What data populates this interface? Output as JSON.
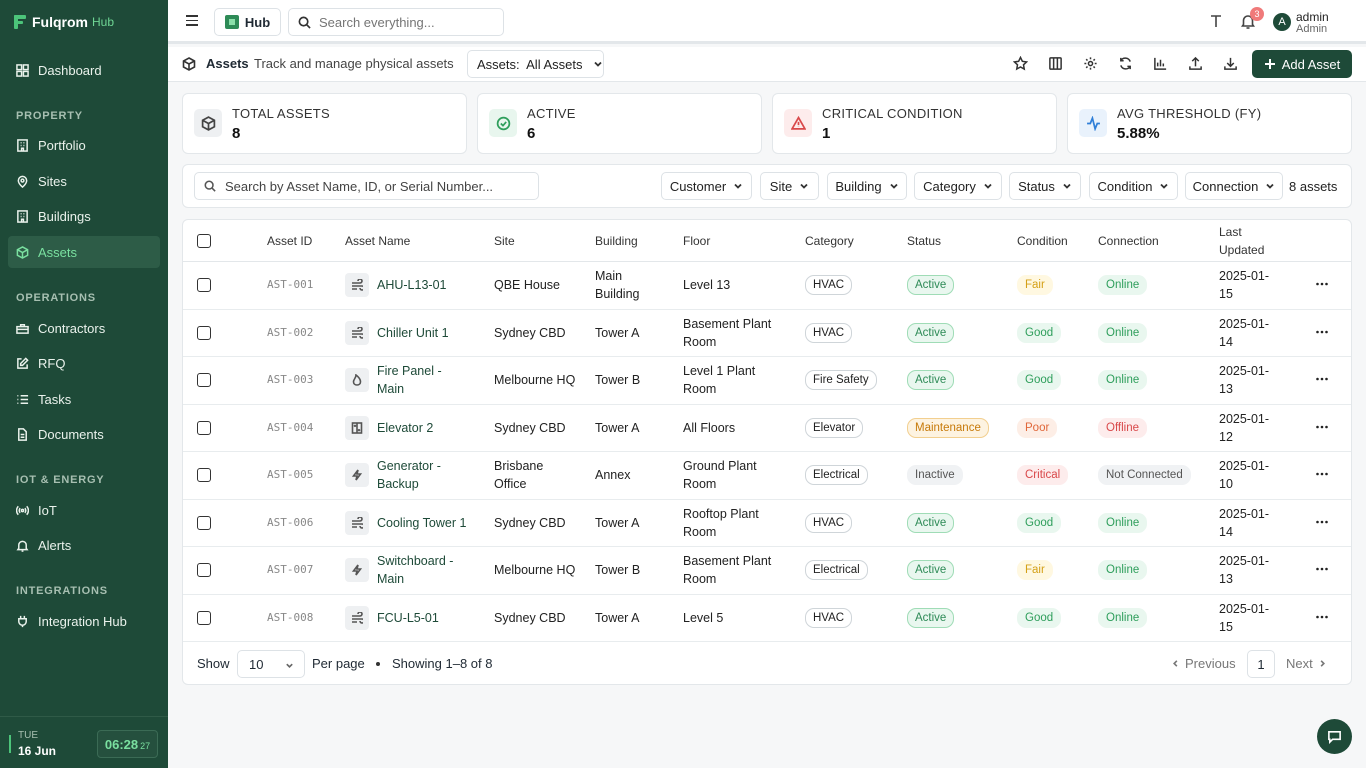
{
  "brand": {
    "name": "Fulqrom",
    "sub": "Hub"
  },
  "sidebar": {
    "dashboard": "Dashboard",
    "sections": [
      "PROPERTY",
      "OPERATIONS",
      "IOT & ENERGY",
      "INTEGRATIONS"
    ],
    "items": [
      {
        "label": "Portfolio",
        "icon": "building-icon"
      },
      {
        "label": "Sites",
        "icon": "pin-icon"
      },
      {
        "label": "Buildings",
        "icon": "building-icon"
      },
      {
        "label": "Assets",
        "icon": "box-icon",
        "active": true
      },
      {
        "label": "Contractors",
        "icon": "toolbox-icon"
      },
      {
        "label": "RFQ",
        "icon": "edit-icon"
      },
      {
        "label": "Tasks",
        "icon": "list-icon"
      },
      {
        "label": "Documents",
        "icon": "document-icon"
      },
      {
        "label": "IoT",
        "icon": "signal-icon"
      },
      {
        "label": "Alerts",
        "icon": "bell-icon"
      },
      {
        "label": "Integration Hub",
        "icon": "plug-icon"
      }
    ],
    "footer": {
      "day": "TUE",
      "date": "16 Jun",
      "time": "06:28",
      "seconds": "27"
    }
  },
  "topbar": {
    "hub_label": "Hub",
    "search_placeholder": "Search everything...",
    "notification_count": "3",
    "avatar_initial": "A",
    "user_name": "admin",
    "user_role": "Admin"
  },
  "page": {
    "title": "Assets",
    "description": "Track and manage physical assets",
    "view_select": "Assets:  All Assets",
    "add_button": "Add Asset"
  },
  "stats": [
    {
      "label": "TOTAL ASSETS",
      "value": "8",
      "color": "#444444",
      "bg": "#eef0f2"
    },
    {
      "label": "ACTIVE",
      "value": "6",
      "color": "#2e9e5b",
      "bg": "#e8f6ee"
    },
    {
      "label": "CRITICAL CONDITION",
      "value": "1",
      "color": "#d9484a",
      "bg": "#fdecec"
    },
    {
      "label": "AVG THRESHOLD (FY)",
      "value": "5.88%",
      "color": "#2f7fd8",
      "bg": "#e9f2fc"
    }
  ],
  "filters": {
    "search_placeholder": "Search by Asset Name, ID, or Serial Number...",
    "labels": [
      "Customer",
      "Site",
      "Building",
      "Category",
      "Status",
      "Condition",
      "Connection"
    ],
    "count": "8 assets"
  },
  "table": {
    "headers": [
      "Asset ID",
      "Asset Name",
      "Site",
      "Building",
      "Floor",
      "Category",
      "Status",
      "Condition",
      "Connection",
      "Last\nUpdated"
    ],
    "rows": [
      {
        "id": "AST-001",
        "icon": "hvac-icon",
        "name": "AHU-L13-01",
        "site": "QBE House",
        "building": "Main Building",
        "floor": "Level 13",
        "category": "HVAC",
        "status": "Active",
        "condition": "Fair",
        "connection": "Online",
        "updated": "2025-01-15"
      },
      {
        "id": "AST-002",
        "icon": "hvac-icon",
        "name": "Chiller Unit 1",
        "site": "Sydney CBD",
        "building": "Tower A",
        "floor": "Basement Plant Room",
        "category": "HVAC",
        "status": "Active",
        "condition": "Good",
        "connection": "Online",
        "updated": "2025-01-14"
      },
      {
        "id": "AST-003",
        "icon": "flame-icon",
        "name": "Fire Panel - Main",
        "site": "Melbourne HQ",
        "building": "Tower B",
        "floor": "Level 1 Plant Room",
        "category": "Fire Safety",
        "status": "Active",
        "condition": "Good",
        "connection": "Online",
        "updated": "2025-01-13"
      },
      {
        "id": "AST-004",
        "icon": "elevator-icon",
        "name": "Elevator 2",
        "site": "Sydney CBD",
        "building": "Tower A",
        "floor": "All Floors",
        "category": "Elevator",
        "status": "Maintenance",
        "condition": "Poor",
        "connection": "Offline",
        "updated": "2025-01-12"
      },
      {
        "id": "AST-005",
        "icon": "bolt-icon",
        "name": "Generator - Backup",
        "site": "Brisbane Office",
        "building": "Annex",
        "floor": "Ground Plant Room",
        "category": "Electrical",
        "status": "Inactive",
        "condition": "Critical",
        "connection": "Not Connected",
        "updated": "2025-01-10"
      },
      {
        "id": "AST-006",
        "icon": "hvac-icon",
        "name": "Cooling Tower 1",
        "site": "Sydney CBD",
        "building": "Tower A",
        "floor": "Rooftop Plant Room",
        "category": "HVAC",
        "status": "Active",
        "condition": "Good",
        "connection": "Online",
        "updated": "2025-01-14"
      },
      {
        "id": "AST-007",
        "icon": "bolt-icon",
        "name": "Switchboard - Main",
        "site": "Melbourne HQ",
        "building": "Tower B",
        "floor": "Basement Plant Room",
        "category": "Electrical",
        "status": "Active",
        "condition": "Fair",
        "connection": "Online",
        "updated": "2025-01-13"
      },
      {
        "id": "AST-008",
        "icon": "hvac-icon",
        "name": "FCU-L5-01",
        "site": "Sydney CBD",
        "building": "Tower A",
        "floor": "Level 5",
        "category": "HVAC",
        "status": "Active",
        "condition": "Good",
        "connection": "Online",
        "updated": "2025-01-15"
      }
    ]
  },
  "pill_colors": {
    "Active": {
      "fg": "#2e8b57",
      "bg": "#e9f7ef",
      "bd": "#9fdcb6"
    },
    "Maintenance": {
      "fg": "#c77a0a",
      "bg": "#fdf3e1",
      "bd": "#f2cf8f"
    },
    "Inactive": {
      "fg": "#555555",
      "bg": "#f0f2f4",
      "bd": "#f0f2f4"
    },
    "Fair": {
      "fg": "#d4a017",
      "bg": "#fff8e1",
      "bd": "#fff8e1"
    },
    "Good": {
      "fg": "#2e9e5b",
      "bg": "#e9f7ef",
      "bd": "#e9f7ef"
    },
    "Poor": {
      "fg": "#e0673a",
      "bg": "#fdeee6",
      "bd": "#fdeee6"
    },
    "Critical": {
      "fg": "#d9484a",
      "bg": "#fdecec",
      "bd": "#fdecec"
    },
    "Online": {
      "fg": "#2e9e5b",
      "bg": "#e9f7ef",
      "bd": "#e9f7ef"
    },
    "Offline": {
      "fg": "#d9484a",
      "bg": "#fdecec",
      "bd": "#fdecec"
    },
    "Not Connected": {
      "fg": "#555555",
      "bg": "#f0f2f4",
      "bd": "#f0f2f4"
    }
  },
  "pagination": {
    "show_label": "Show",
    "per_page_value": "10",
    "per_page_label": "Per page",
    "showing": "Showing 1–8 of 8",
    "prev": "Previous",
    "page": "1",
    "next": "Next"
  }
}
